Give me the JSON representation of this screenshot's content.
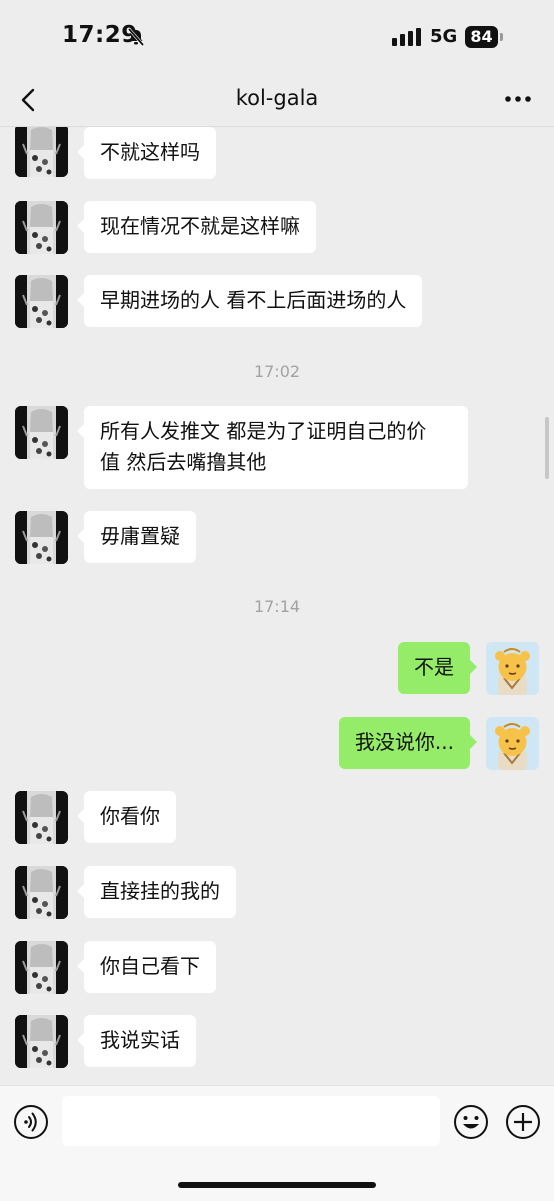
{
  "status": {
    "time": "17:29",
    "network": "5G",
    "battery": "84"
  },
  "nav": {
    "title": "kol-gala"
  },
  "messages": [
    {
      "text": "不就这样吗"
    },
    {
      "text": "现在情况不就是这样嘛"
    },
    {
      "text": "早期进场的人 看不上后面进场的人"
    },
    {
      "time": "17:02"
    },
    {
      "line1": "所有人发推文 都是为了证明自己的价",
      "line2": "值 然后去嘴撸其他"
    },
    {
      "text": "毋庸置疑"
    },
    {
      "time": "17:14"
    },
    {
      "text": "不是"
    },
    {
      "text": "我没说你..."
    },
    {
      "text": "你看你"
    },
    {
      "text": "直接挂的我的"
    },
    {
      "text": "你自己看下"
    },
    {
      "text": "我说实话"
    }
  ]
}
